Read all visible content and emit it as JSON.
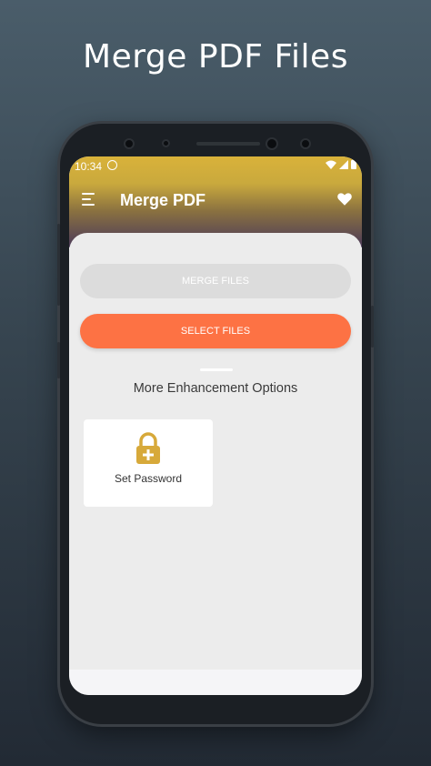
{
  "promo": {
    "title": "Merge PDF Files"
  },
  "status_bar": {
    "time": "10:34"
  },
  "toolbar": {
    "title": "Merge PDF"
  },
  "actions": {
    "merge_label": "MERGE FILES",
    "select_label": "SELECT FILES"
  },
  "enhancements": {
    "heading": "More Enhancement Options",
    "options": [
      {
        "label": "Set Password",
        "icon": "lock-plus-icon"
      }
    ]
  },
  "colors": {
    "accent_orange": "#fd7244",
    "header_gold": "#d9b23a",
    "lock_gold": "#d7a93a",
    "disabled_gray": "#dcdcdc"
  }
}
